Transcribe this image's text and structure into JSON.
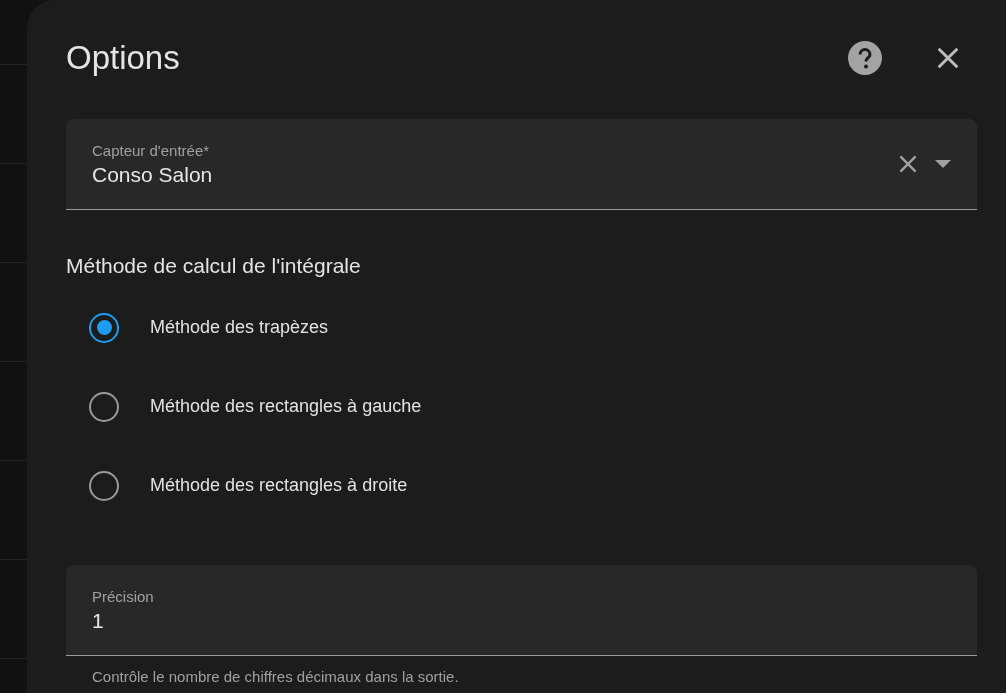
{
  "dialog": {
    "title": "Options"
  },
  "sensor_field": {
    "label": "Capteur d'entrée*",
    "value": "Conso Salon"
  },
  "method": {
    "heading": "Méthode de calcul de l'intégrale",
    "options": [
      {
        "label": "Méthode des trapèzes",
        "selected": true
      },
      {
        "label": "Méthode des rectangles à gauche",
        "selected": false
      },
      {
        "label": "Méthode des rectangles à droite",
        "selected": false
      }
    ]
  },
  "precision_field": {
    "label": "Précision",
    "value": "1",
    "helper": "Contrôle le nombre de chiffres décimaux dans la sortie."
  }
}
